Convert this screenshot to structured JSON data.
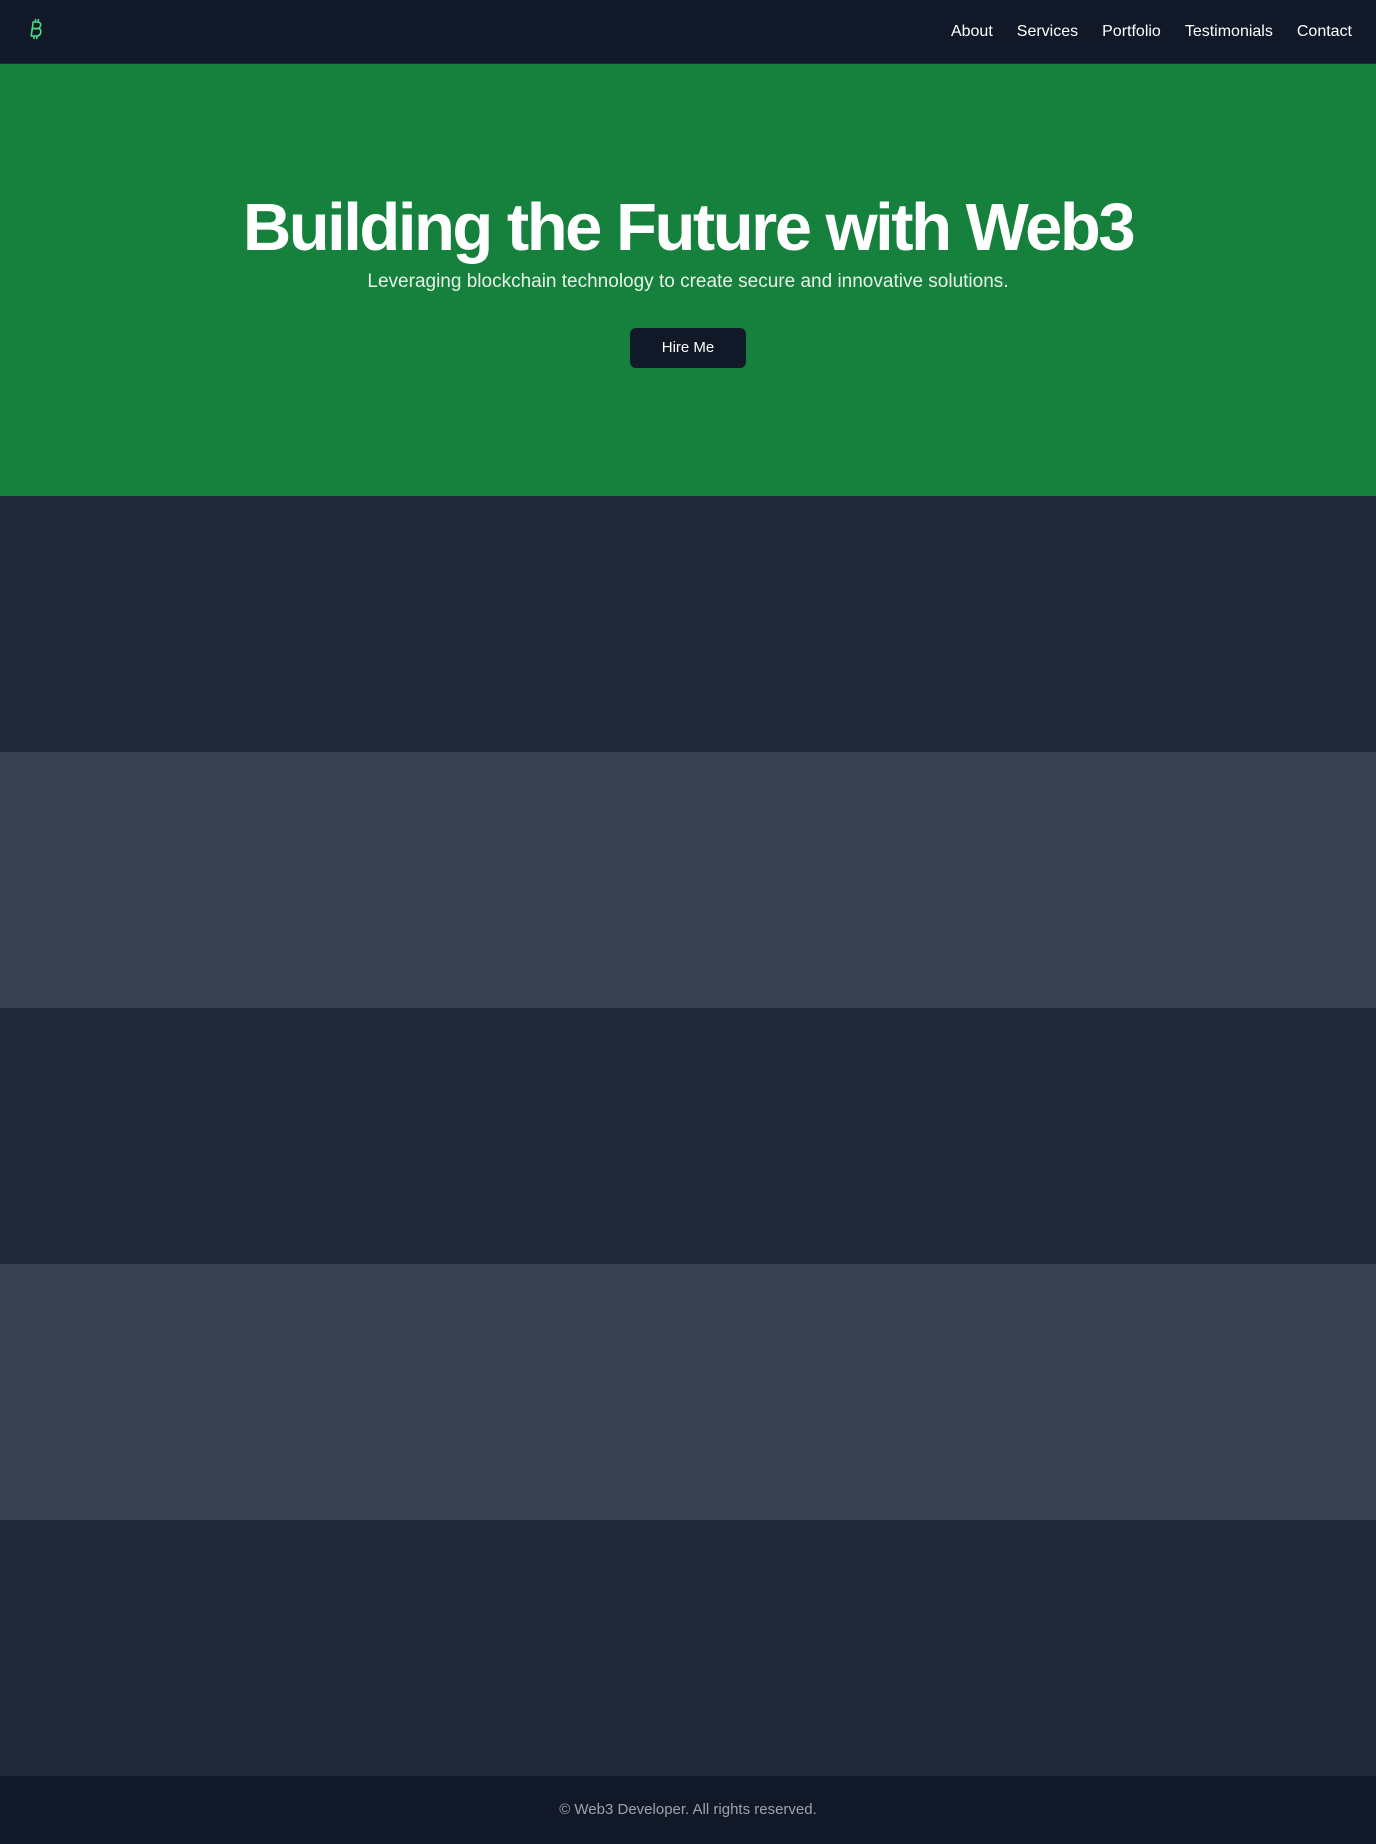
{
  "navbar": {
    "logo_icon": "bitcoin-icon",
    "logo_color": "#4ade80",
    "links": [
      "About",
      "Services",
      "Portfolio",
      "Testimonials",
      "Contact"
    ]
  },
  "hero": {
    "title": "Building the Future with Web3",
    "subtitle": "Leveraging blockchain technology to create secure and innovative solutions.",
    "cta_label": "Hire Me",
    "background": "#16803d"
  },
  "footer": {
    "text": "© Web3 Developer. All rights reserved."
  }
}
